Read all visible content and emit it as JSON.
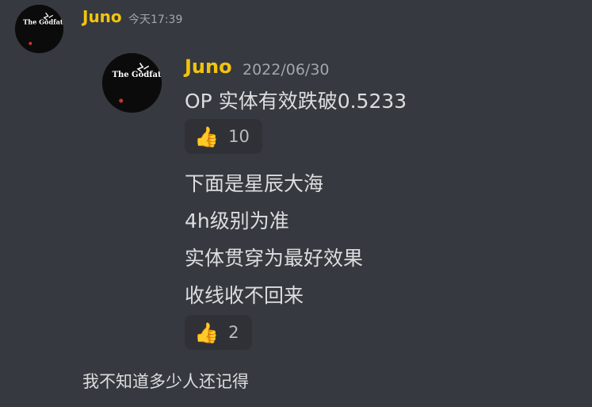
{
  "outer_message": {
    "username": "Juno",
    "timestamp": "今天17:39",
    "text": "我不知道多少人还记得"
  },
  "forwarded_message": {
    "username": "Juno",
    "timestamp": "2022/06/30",
    "lines_group1": [
      "OP 实体有效跌破0.5233"
    ],
    "reaction1": {
      "emoji": "👍",
      "count": "10"
    },
    "lines_group2": [
      "下面是星辰大海",
      "4h级别为准",
      "实体贯穿为最好效果",
      "收线收不回来"
    ],
    "reaction2": {
      "emoji": "👍",
      "count": "2"
    }
  },
  "avatar": {
    "logo_text": "The Godfather",
    "icon": "godfather-logo"
  },
  "colors": {
    "background": "#36393f",
    "username": "#f1c40f",
    "reaction_bg": "#2f3136",
    "timestamp": "#a3a6aa",
    "text": "#dcddde"
  }
}
